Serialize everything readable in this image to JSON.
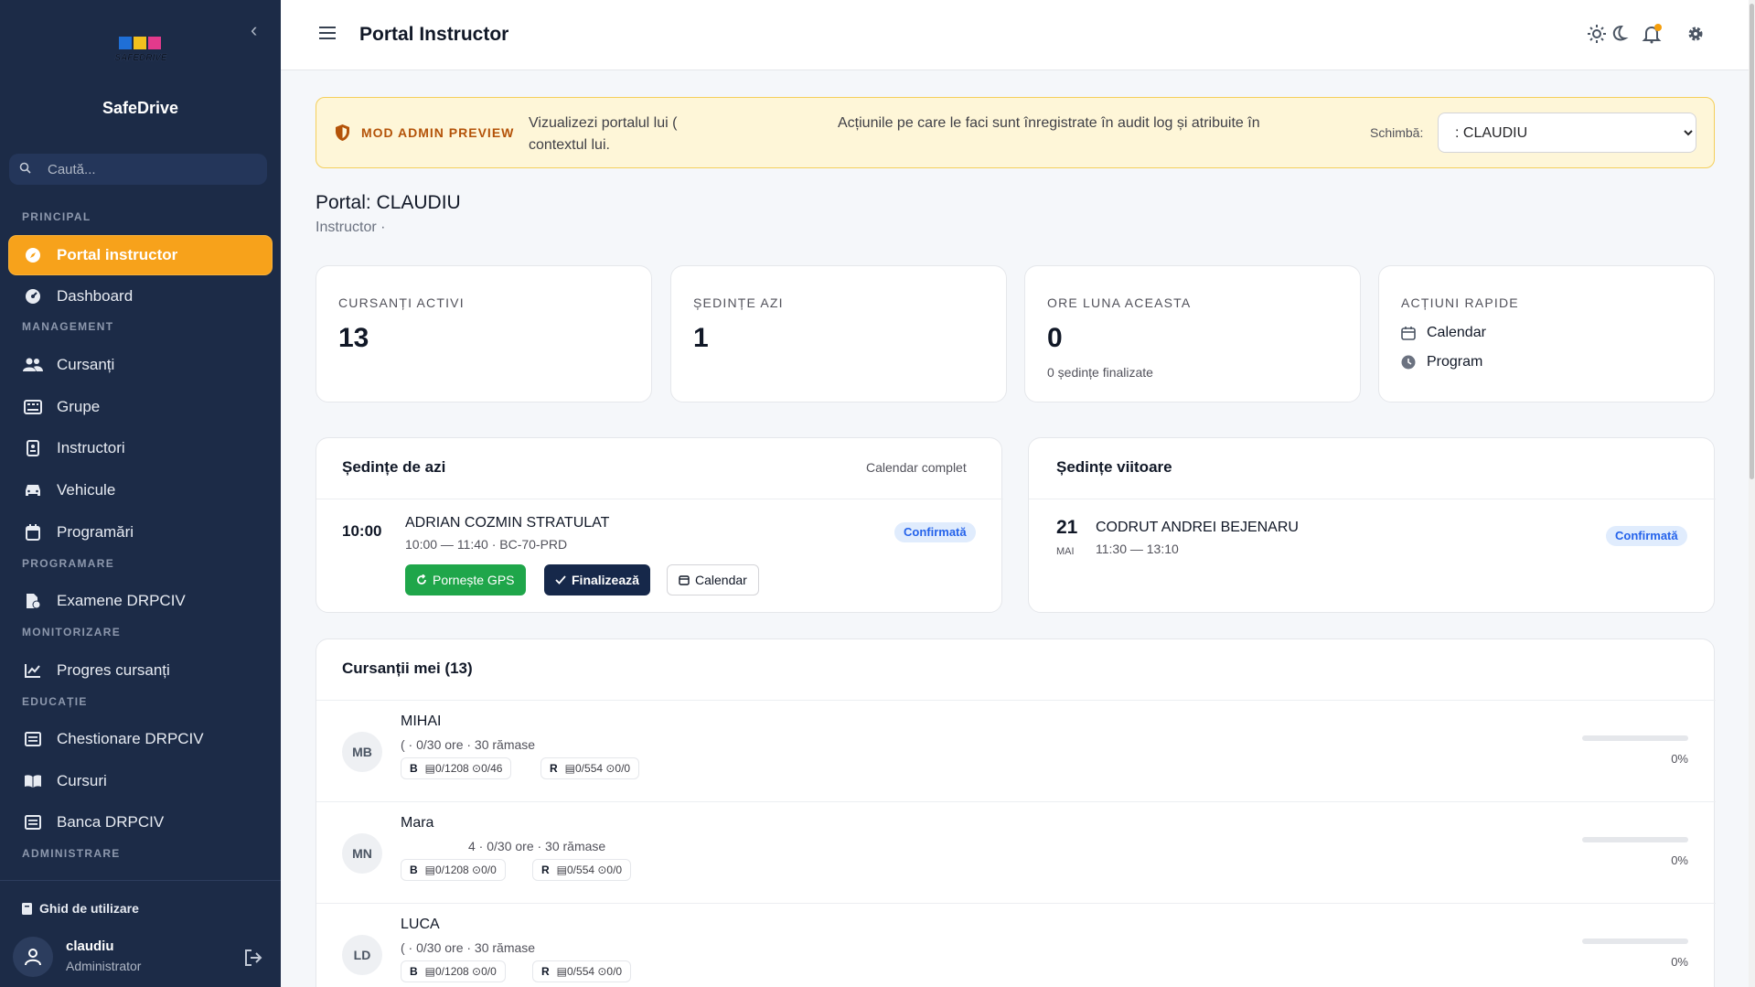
{
  "sidebar": {
    "logo_text": "SAFEDRIVE",
    "brand": "SafeDrive",
    "search_placeholder": "Caută...",
    "sections": {
      "principal": "PRINCIPAL",
      "management": "MANAGEMENT",
      "programare": "PROGRAMARE",
      "monitorizare": "MONITORIZARE",
      "educatie": "EDUCAȚIE",
      "administrare": "ADMINISTRARE"
    },
    "items": [
      {
        "label": "Portal instructor",
        "icon": "compass-icon"
      },
      {
        "label": "Dashboard",
        "icon": "gauge-icon"
      },
      {
        "label": "Cursanți",
        "icon": "users-icon"
      },
      {
        "label": "Grupe",
        "icon": "keyboard-icon"
      },
      {
        "label": "Instructori",
        "icon": "id-badge-icon"
      },
      {
        "label": "Vehicule",
        "icon": "car-icon"
      },
      {
        "label": "Programări",
        "icon": "calendar-icon"
      },
      {
        "label": "Examene DRPCIV",
        "icon": "file-check-icon"
      },
      {
        "label": "Progres cursanți",
        "icon": "chart-line-icon"
      },
      {
        "label": "Chestionare DRPCIV",
        "icon": "list-icon"
      },
      {
        "label": "Cursuri",
        "icon": "book-icon"
      },
      {
        "label": "Banca DRPCIV",
        "icon": "list-icon"
      }
    ],
    "guide": "Ghid de utilizare",
    "user": {
      "name": "claudiu",
      "role": "Administrator"
    }
  },
  "topbar": {
    "title": "Portal Instructor"
  },
  "banner": {
    "title": "MOD ADMIN PREVIEW",
    "message1": "Vizualizezi portalul lui ( contextul lui.",
    "message2": "Acțiunile pe care le faci sunt înregistrate în audit log și atribuite în",
    "switch_label": "Schimbă:",
    "selected": ": CLAUDIU"
  },
  "portal": {
    "heading": "Portal: CLAUDIU",
    "subtitle": "Instructor ·"
  },
  "stats": {
    "active": {
      "label": "CURSANȚI ACTIVI",
      "value": "13"
    },
    "today": {
      "label": "ȘEDINȚE AZI",
      "value": "1"
    },
    "hours": {
      "label": "ORE LUNA ACEASTA",
      "value": "0",
      "note": "0 ședințe finalizate"
    },
    "quick": {
      "label": "ACȚIUNI RAPIDE",
      "calendar": "Calendar",
      "program": "Program"
    }
  },
  "today_sessions": {
    "title": "Ședințe de azi",
    "link": "Calendar complet",
    "session": {
      "time": "10:00",
      "student": "ADRIAN COZMIN STRATULAT",
      "details": "10:00 — 11:40 · BC-70-PRD",
      "status": "Confirmată",
      "gps_btn": "Pornește GPS",
      "finish_btn": "Finalizează",
      "calendar_btn": "Calendar"
    }
  },
  "upcoming": {
    "title": "Ședințe viitoare",
    "session": {
      "day": "21",
      "month": "MAI",
      "student": "CODRUT ANDREI BEJENARU",
      "time": "11:30 — 13:10",
      "status": "Confirmată"
    }
  },
  "students": {
    "title": "Cursanții mei (13)",
    "list": [
      {
        "initials": "MB",
        "name": "MIHAI",
        "info": "( · 0/30 ore · 30 rămase",
        "chip1_cat": "B",
        "chip1": "▤0/1208 ⊙0/46",
        "chip2_cat": "R",
        "chip2": "▤0/554 ⊙0/0",
        "progress": 0,
        "pct": "0%"
      },
      {
        "initials": "MN",
        "name": "Mara",
        "info": "4 · 0/30 ore · 30 rămase",
        "chip1_cat": "B",
        "chip1": "▤0/1208 ⊙0/0",
        "chip2_cat": "R",
        "chip2": "▤0/554 ⊙0/0",
        "progress": 0,
        "pct": "0%"
      },
      {
        "initials": "LD",
        "name": "LUCA",
        "info": "( · 0/30 ore · 30 rămase",
        "chip1_cat": "B",
        "chip1": "▤0/1208 ⊙0/0",
        "chip2_cat": "R",
        "chip2": "▤0/554 ⊙0/0",
        "progress": 0,
        "pct": "0%"
      }
    ]
  },
  "colors": {
    "sidebar": "#1c2b47",
    "accent": "#f7a21b",
    "navy": "#16284a",
    "green": "#1fa64a",
    "badge": "#2563eb"
  }
}
